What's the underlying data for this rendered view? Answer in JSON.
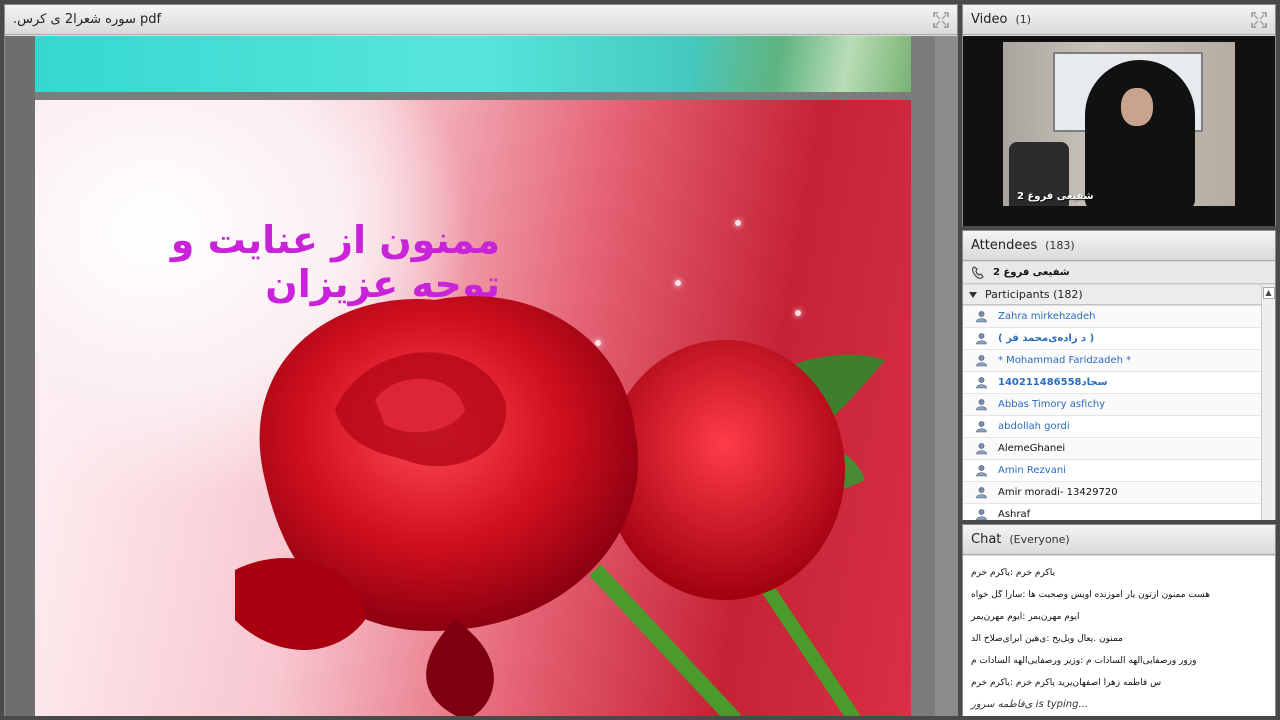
{
  "share": {
    "title": ".سوره شعرا2 ی کرس pdf",
    "slide_text": "ممنون از عنایت و توجه عزیزان"
  },
  "video": {
    "title": "Video",
    "count": "(1)",
    "presenter_label": "شفیعی فروغ 2"
  },
  "attendees": {
    "title": "Attendees",
    "count": "(183)",
    "host_name": "شفیعی فروغ 2",
    "participants_label": "Participants (182)",
    "list": [
      {
        "name": "Zahra mirkehzadeh",
        "style": "blue"
      },
      {
        "name": "( د زاده‌ی‌محمد قر )",
        "style": "blue bold"
      },
      {
        "name": "* Mohammad Faridzadeh *",
        "style": "blue"
      },
      {
        "name": "140211486558سجاد",
        "style": "blue bold"
      },
      {
        "name": "Abbas Timory asfichy",
        "style": "blue"
      },
      {
        "name": "abdollah gordi",
        "style": "blue"
      },
      {
        "name": "AlemeGhanei",
        "style": "dark"
      },
      {
        "name": "Amin Rezvani",
        "style": "blue"
      },
      {
        "name": "Amir moradi- 13429720",
        "style": "dark"
      },
      {
        "name": "Ashraf",
        "style": "dark"
      }
    ]
  },
  "chat": {
    "title": "Chat",
    "scope": "(Everyone)",
    "messages": [
      "یاکرم خرم :یاکرم خرم",
      "هست ممنون ازتون  یار اموزنده اویس وصحبت ها :سارا گل خواه",
      "ایوم مهرن‌یمر :ایوم مهرن‌یمر",
      "ممنون .یعال ویل‌یح :ی‌هین ابرای‌صلاح الد",
      "وزور ورصفایی‌الهه السادات م :وزیر ورصفایی‌الهه السادات م",
      "س فاطمه زهرا اصفهان‌یرید یاکرم خرم :یاکرم خرم"
    ],
    "typing": "ی‌فاطمه سرور is typing..."
  },
  "colors": {
    "slide_title": "#c823d8",
    "link_blue": "#2a6cc0"
  }
}
